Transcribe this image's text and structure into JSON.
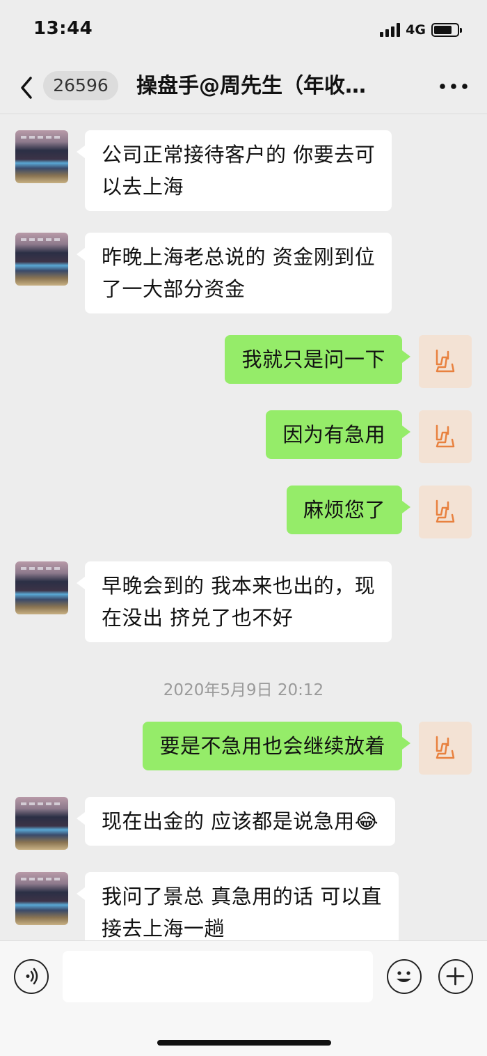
{
  "status_bar": {
    "time": "13:44",
    "network": "4G"
  },
  "nav": {
    "unread_count": "26596",
    "title": "操盘手@周先生（年收…",
    "back_icon": "chevron-left-icon",
    "more_icon": "more-dots-icon"
  },
  "messages": [
    {
      "side": "left",
      "text_lines": [
        "公司正常接待客户的 你要去可",
        "以去上海"
      ]
    },
    {
      "side": "left",
      "text_lines": [
        "昨晚上海老总说的 资金刚到位",
        "了一大部分资金"
      ]
    },
    {
      "side": "right",
      "text_lines": [
        "我就只是问一下"
      ]
    },
    {
      "side": "right",
      "text_lines": [
        "因为有急用"
      ]
    },
    {
      "side": "right",
      "text_lines": [
        "麻烦您了"
      ]
    },
    {
      "side": "left",
      "text_lines": [
        "早晚会到的 我本来也出的，现",
        "在没出 挤兑了也不好"
      ]
    },
    {
      "side": "right",
      "text_lines": [
        "要是不急用也会继续放着"
      ]
    },
    {
      "side": "left",
      "text_lines": [
        "现在出金的 应该都是说急用😂"
      ]
    },
    {
      "side": "left",
      "text_lines": [
        "我问了景总 真急用的话 可以直",
        "接去上海一趟"
      ]
    }
  ],
  "timestamp": "2020年5月9日 20:12",
  "input_bar": {
    "voice_icon": "voice-icon",
    "emoji_icon": "emoji-icon",
    "plus_icon": "plus-icon"
  },
  "colors": {
    "background": "#ededed",
    "bubble_self": "#95ec69",
    "bubble_other": "#ffffff",
    "timestamp": "#9a9a9a"
  }
}
